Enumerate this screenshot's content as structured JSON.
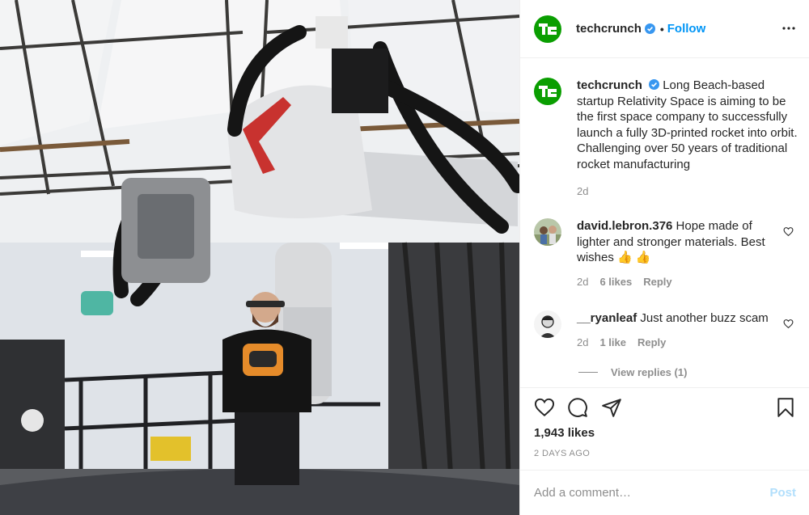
{
  "header": {
    "username": "techcrunch",
    "separator": "•",
    "follow_label": "Follow",
    "icons": {
      "verified": "verified-badge-icon",
      "more": "more-options-icon",
      "logo": "techcrunch-logo"
    }
  },
  "caption": {
    "username": "techcrunch",
    "text": "Long Beach-based startup Relativity Space is aiming to be the first space company to successfully launch a fully 3D-printed rocket into orbit. Challenging over 50 years of traditional rocket manufacturing",
    "time": "2d"
  },
  "comments": [
    {
      "username": "david.lebron.376",
      "text": "Hope made of lighter and stronger materials. Best wishes 👍 👍",
      "time": "2d",
      "likes": "6 likes",
      "reply_label": "Reply"
    },
    {
      "username": "__ryanleaf",
      "text": "Just another buzz scam",
      "time": "2d",
      "likes": "1 like",
      "reply_label": "Reply"
    }
  ],
  "view_replies_label": "View replies (1)",
  "actions": {
    "icons": [
      "heart-icon",
      "comment-icon",
      "share-icon",
      "bookmark-icon"
    ]
  },
  "likes_count": "1,943 likes",
  "post_date": "2 DAYS AGO",
  "add_comment": {
    "placeholder": "Add a comment…",
    "post_label": "Post"
  },
  "colors": {
    "brand": "#0a9e01",
    "link": "#0095f6",
    "muted": "#8e8e8e",
    "post_disabled": "#b2dffc"
  }
}
